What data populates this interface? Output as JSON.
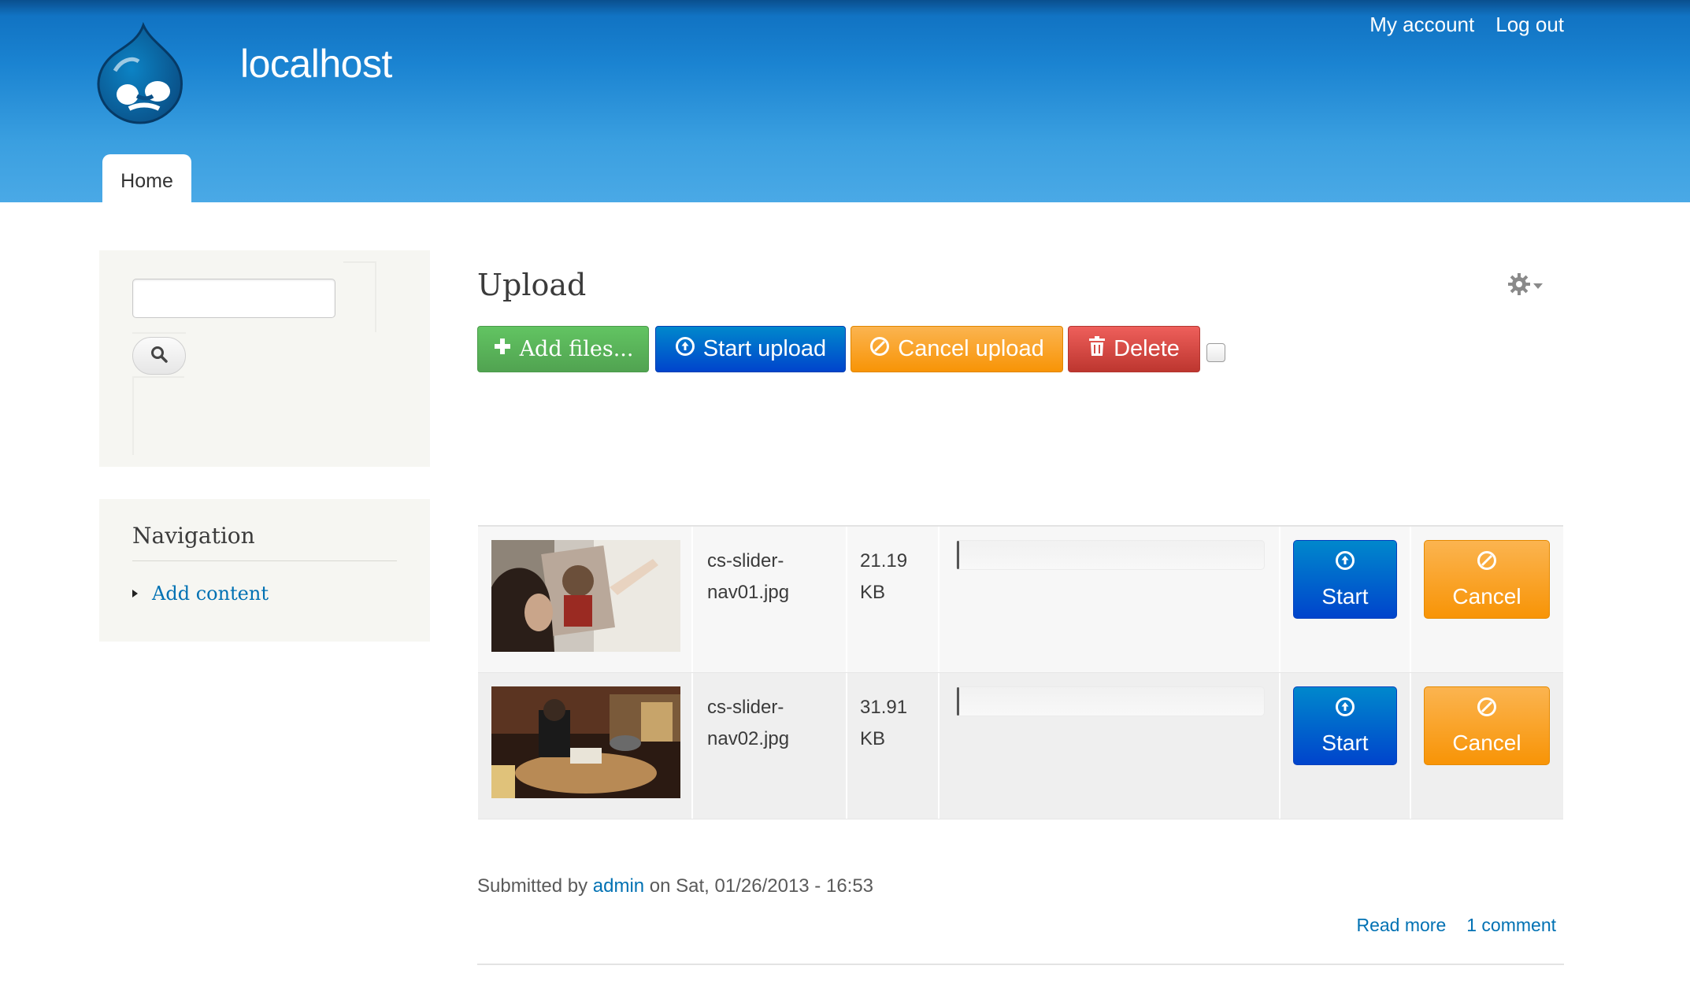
{
  "header": {
    "site_name": "localhost",
    "secondary_menu": [
      "My account",
      "Log out"
    ],
    "main_tab": "Home"
  },
  "sidebar": {
    "search": {
      "input_value": "",
      "button_icon": "search-icon"
    },
    "navigation": {
      "title": "Navigation",
      "items": [
        "Add content"
      ]
    }
  },
  "main": {
    "title": "Upload",
    "toolbar": {
      "add_files": "Add files...",
      "start_upload": "Start upload",
      "cancel_upload": "Cancel upload",
      "delete": "Delete"
    },
    "files": [
      {
        "name_line1": "cs-slider-",
        "name_line2": "nav01.jpg",
        "size_value": "21.19",
        "size_unit": "KB",
        "progress": 0,
        "start": "Start",
        "cancel": "Cancel"
      },
      {
        "name_line1": "cs-slider-",
        "name_line2": "nav02.jpg",
        "size_value": "31.91",
        "size_unit": "KB",
        "progress": 0,
        "start": "Start",
        "cancel": "Cancel"
      }
    ],
    "submitted": {
      "prefix": "Submitted by",
      "author": "admin",
      "suffix": "on Sat, 01/26/2013 - 16:53"
    },
    "links": {
      "read_more": "Read more",
      "comments": "1 comment"
    }
  },
  "colors": {
    "header_blue": "#1a83d1",
    "link_blue": "#0071b3",
    "green": "#51a351",
    "blue": "#0044cc",
    "orange": "#f89406",
    "red": "#bd362f"
  }
}
